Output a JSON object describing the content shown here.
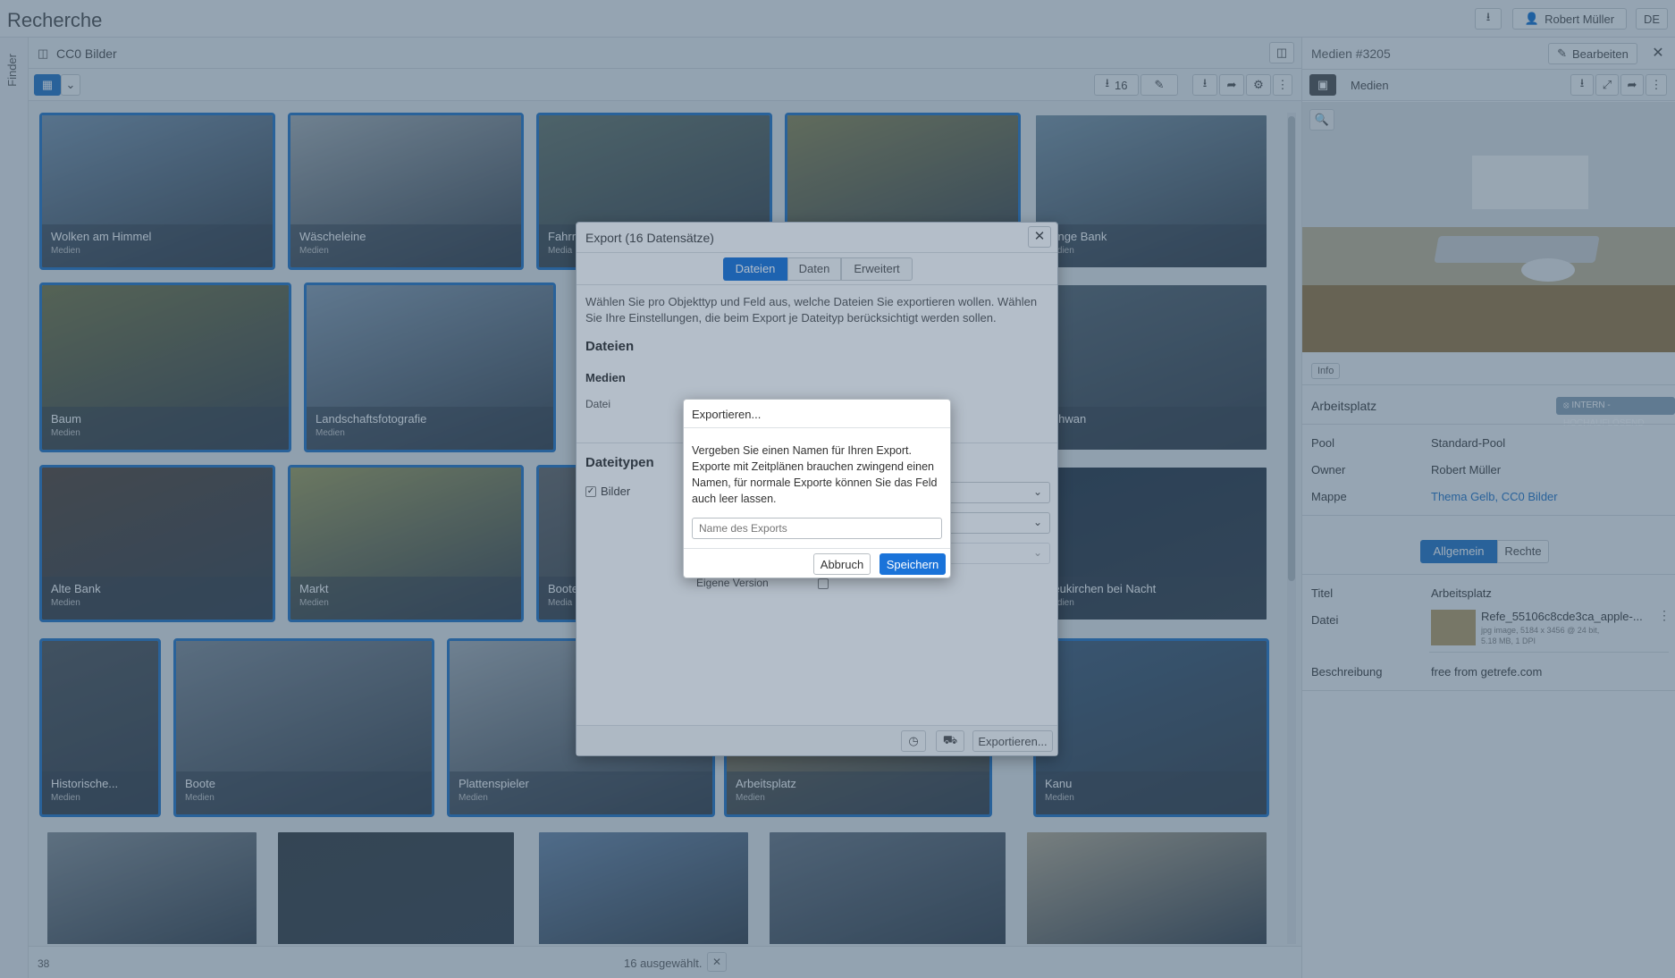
{
  "app": {
    "title": "Recherche",
    "user": "Robert Müller",
    "lang": "DE"
  },
  "finder": {
    "label": "Finder"
  },
  "crumb": {
    "folder": "CC0 Bilder"
  },
  "toolbar": {
    "selected_count": "16"
  },
  "tiles": [
    {
      "title": "Wolken am Himmel",
      "sub": "Medien",
      "color": "#7f97ad"
    },
    {
      "title": "Wäscheleine",
      "sub": "Medien",
      "color": "#a9b0b4"
    },
    {
      "title": "Fahrr",
      "sub": "Media",
      "color": "#6c7a6e"
    },
    {
      "title": "",
      "sub": "",
      "color": "#8f8a58"
    },
    {
      "title": "Lange Bank",
      "sub": "Medien",
      "color": "#7f97a7"
    },
    {
      "title": "Baum",
      "sub": "Medien",
      "color": "#7a7a4a"
    },
    {
      "title": "Landschaftsfotografie",
      "sub": "Medien",
      "color": "#8da0b2"
    },
    {
      "title": "Schwan",
      "sub": "",
      "color": "#5c6a74"
    },
    {
      "title": "Alte Bank",
      "sub": "Medien",
      "color": "#5a4a3e"
    },
    {
      "title": "Markt",
      "sub": "Medien",
      "color": "#a2a060"
    },
    {
      "title": "Boote",
      "sub": "Media",
      "color": "#6b6b6b"
    },
    {
      "title": "Neukirchen bei Nacht",
      "sub": "Medien",
      "color": "#2f3c4c"
    },
    {
      "title": "Historische...",
      "sub": "Medien",
      "color": "#555a5e"
    },
    {
      "title": "Boote",
      "sub": "Medien",
      "color": "#848e98"
    },
    {
      "title": "Plattenspieler",
      "sub": "Medien",
      "color": "#a9b0b6"
    },
    {
      "title": "Arbeitsplatz",
      "sub": "Medien",
      "color": "#b59b66"
    },
    {
      "title": "Kanu",
      "sub": "Medien",
      "color": "#46617c"
    },
    {
      "title": "",
      "sub": "",
      "color": "#8a9298"
    },
    {
      "title": "",
      "sub": "",
      "color": "#3f4448"
    },
    {
      "title": "",
      "sub": "",
      "color": "#708aa8"
    },
    {
      "title": "",
      "sub": "",
      "color": "#6f7a86"
    },
    {
      "title": "",
      "sub": "",
      "color": "#b8ad96"
    }
  ],
  "status": {
    "count": "38",
    "selected": "16 ausgewählt."
  },
  "right": {
    "title": "Medien #3205",
    "edit": "Bearbeiten",
    "mode": "Medien",
    "info": "Info",
    "name": "Arbeitsplatz",
    "badge": "INTERN - HOCHAUFLÖSEND",
    "fields": [
      {
        "label": "Pool",
        "value": "Standard-Pool"
      },
      {
        "label": "Owner",
        "value": "Robert Müller"
      },
      {
        "label": "Mappe",
        "value": "Thema Gelb, CC0 Bilder"
      }
    ],
    "tabs": [
      "Allgemein",
      "Rechte"
    ],
    "titel_label": "Titel",
    "titel_value": "Arbeitsplatz",
    "datei_label": "Datei",
    "file_name": "Refe_55106c8cde3ca_apple-...",
    "file_meta1": "jpg image, 5184 x 3456 @ 24 bit,",
    "file_meta2": "5.18 MB, 1 DPI",
    "beschreibung_label": "Beschreibung",
    "beschreibung_value": "free from getrefe.com"
  },
  "export": {
    "title": "Export (16 Datensätze)",
    "tabs": [
      "Dateien",
      "Daten",
      "Erweitert"
    ],
    "intro": "Wählen Sie pro Objekttyp und Feld aus, welche Dateien Sie exportieren wollen. Wählen Sie Ihre Einstellungen, die beim Export je Dateityp berücksichtigt werden sollen.",
    "h_dateien": "Dateien",
    "h_medien": "Medien",
    "datei_label": "Datei",
    "h_dateitypen": "Dateitypen",
    "bilder": "Bilder",
    "eigene_version": "Eigene Version",
    "export_btn": "Exportieren..."
  },
  "name_dialog": {
    "title": "Exportieren...",
    "text": "Vergeben Sie einen Namen für Ihren Export. Exporte mit Zeitplänen brauchen zwingend einen Namen, für normale Exporte können Sie das Feld auch leer lassen.",
    "placeholder": "Name des Exports",
    "cancel": "Abbruch",
    "save": "Speichern"
  },
  "colors": {
    "accent": "#1a73d9",
    "selection": "#2b78c6"
  }
}
